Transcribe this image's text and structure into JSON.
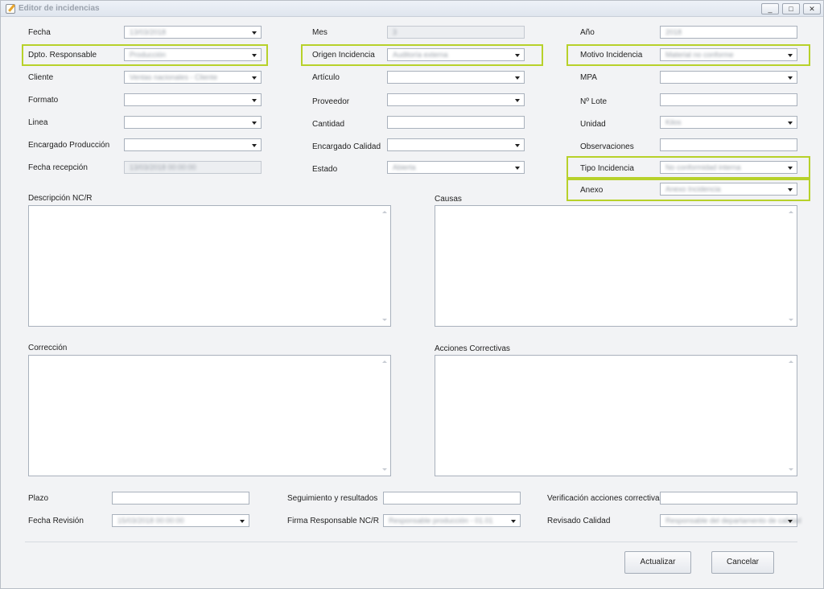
{
  "window": {
    "title": "Editor de incidencias",
    "controls": [
      "_",
      "□",
      "✕"
    ]
  },
  "fields": {
    "fecha": {
      "label": "Fecha",
      "value": "13/03/2018"
    },
    "mes": {
      "label": "Mes",
      "value": "3"
    },
    "anio": {
      "label": "Año",
      "value": "2018"
    },
    "dpto": {
      "label": "Dpto. Responsable",
      "value": "Producción"
    },
    "origen": {
      "label": "Origen Incidencia",
      "value": "Auditoría externa"
    },
    "motivo": {
      "label": "Motivo Incidencia",
      "value": "Material no conforme"
    },
    "cliente": {
      "label": "Cliente",
      "value": "Ventas nacionales - Cliente"
    },
    "articulo": {
      "label": "Artículo",
      "value": ""
    },
    "mpa": {
      "label": "MPA",
      "value": ""
    },
    "formato": {
      "label": "Formato",
      "value": ""
    },
    "proveedor": {
      "label": "Proveedor",
      "value": ""
    },
    "lote": {
      "label": "Nº Lote",
      "value": ""
    },
    "linea": {
      "label": "Linea",
      "value": ""
    },
    "cantidad": {
      "label": "Cantidad",
      "value": ""
    },
    "unidad": {
      "label": "Unidad",
      "value": "Kilos"
    },
    "encargado_prod": {
      "label": "Encargado Producción",
      "value": ""
    },
    "encargado_cal": {
      "label": "Encargado Calidad",
      "value": ""
    },
    "observaciones": {
      "label": "Observaciones",
      "value": ""
    },
    "fecha_recepcion": {
      "label": "Fecha recepción",
      "value": "13/03/2018 00:00:00"
    },
    "estado": {
      "label": "Estado",
      "value": "Abierta"
    },
    "tipo": {
      "label": "Tipo Incidencia",
      "value": "No conformidad interna"
    },
    "anexo": {
      "label": "Anexo",
      "value": "Anexo Incidencia"
    }
  },
  "textareas": {
    "descripcion": {
      "label": "Descripción NC/R",
      "value": ""
    },
    "causas": {
      "label": "Causas",
      "value": ""
    },
    "correccion": {
      "label": "Corrección",
      "value": ""
    },
    "acciones": {
      "label": "Acciones Correctivas",
      "value": ""
    }
  },
  "bottom": {
    "plazo": {
      "label": "Plazo",
      "value": ""
    },
    "seguimiento": {
      "label": "Seguimiento y resultados",
      "value": ""
    },
    "verificacion": {
      "label": "Verificación acciones correctivas",
      "value": ""
    },
    "fecha_revision": {
      "label": "Fecha Revisión",
      "value": "15/03/2018 00:00:00"
    },
    "firma": {
      "label": "Firma Responsable NC/R",
      "value": "Responsable producción - 01.01"
    },
    "revisado": {
      "label": "Revisado Calidad",
      "value": "Responsable del departamento de calidad"
    }
  },
  "buttons": {
    "actualizar": "Actualizar",
    "cancelar": "Cancelar"
  },
  "colors": {
    "highlight": "#b7d12a"
  }
}
